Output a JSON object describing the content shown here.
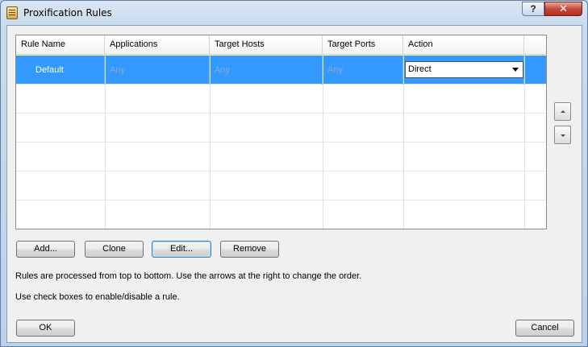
{
  "window": {
    "title": "Proxification Rules",
    "help_label": "?",
    "close_label": "✕"
  },
  "grid": {
    "columns": [
      "Rule Name",
      "Applications",
      "Target Hosts",
      "Target Ports",
      "Action"
    ],
    "rows": [
      {
        "name": "Default",
        "applications": "Any",
        "target_hosts": "Any",
        "target_ports": "Any",
        "action": "Direct",
        "selected": true
      }
    ]
  },
  "buttons": {
    "add": "Add...",
    "clone": "Clone",
    "edit": "Edit...",
    "remove": "Remove",
    "ok": "OK",
    "cancel": "Cancel"
  },
  "hints": {
    "order": "Rules are processed from top to bottom. Use the arrows at the right to change the order.",
    "checkboxes": "Use check boxes to enable/disable a rule."
  },
  "icons": {
    "app": "rules-list-icon",
    "move_up": "arrow-up-icon",
    "move_down": "arrow-down-icon"
  }
}
